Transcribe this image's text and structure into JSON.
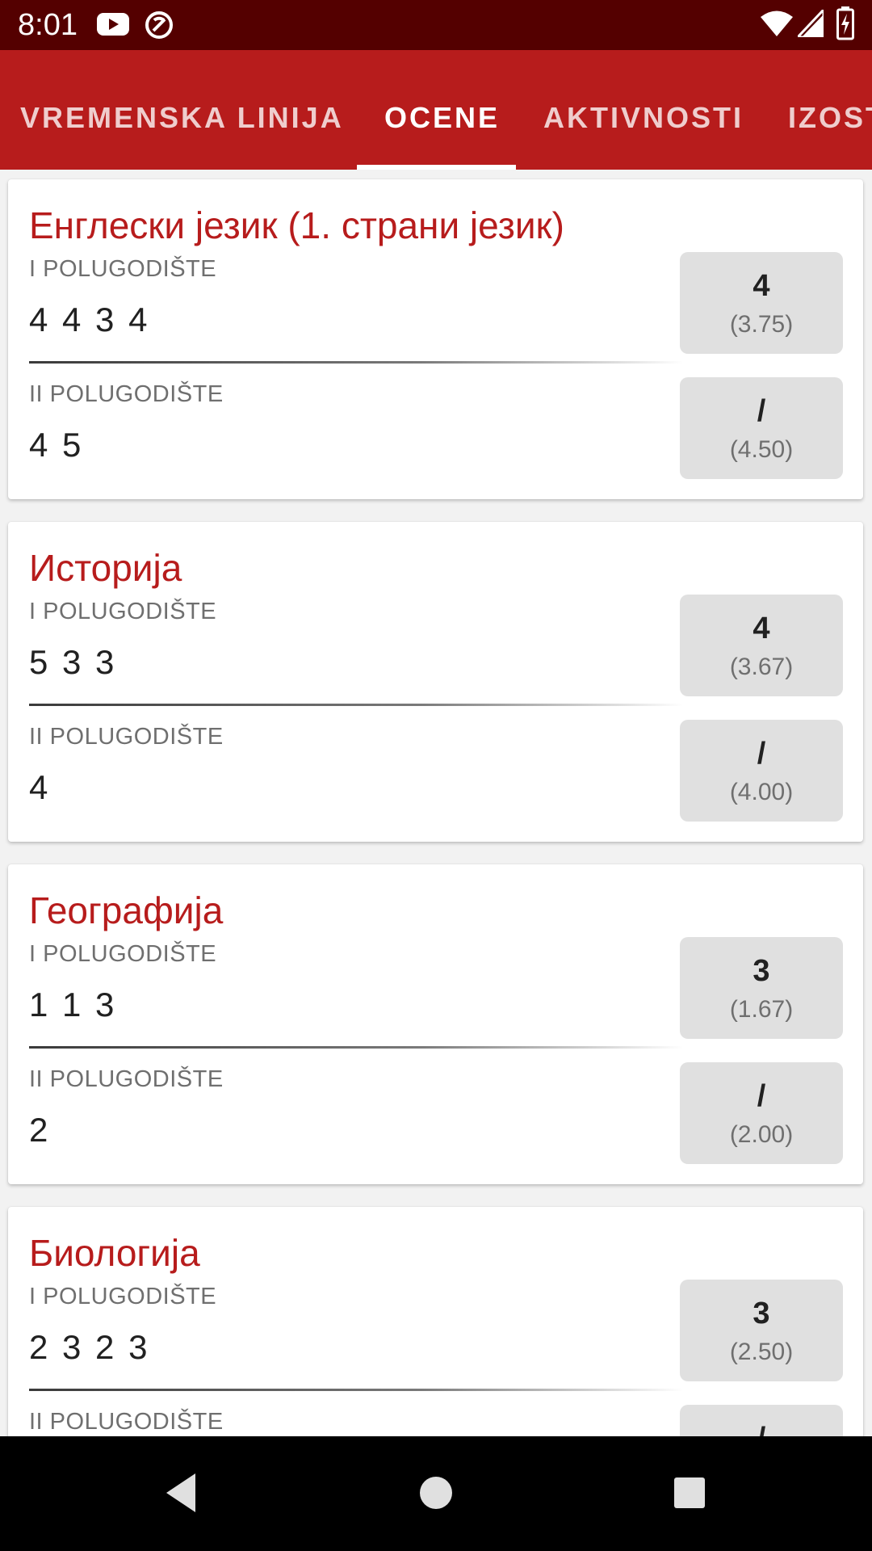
{
  "status_bar": {
    "time": "8:01",
    "icons": [
      "youtube-icon",
      "notification-icon",
      "wifi-icon",
      "signal-icon",
      "battery-charging-icon"
    ]
  },
  "tabs": [
    {
      "label": "VREMENSKA LINIJA",
      "active": false
    },
    {
      "label": "OCENE",
      "active": true
    },
    {
      "label": "AKTIVNOSTI",
      "active": false
    },
    {
      "label": "IZOSTANCI",
      "active": false
    }
  ],
  "subjects": [
    {
      "name": "Енглески језик (1. страни језик)",
      "terms": [
        {
          "label": "I POLUGODIŠTE",
          "grades": "4 4 3 4",
          "final": "4",
          "average": "(3.75)"
        },
        {
          "label": "II POLUGODIŠTE",
          "grades": "4 5",
          "final": "/",
          "average": "(4.50)"
        }
      ]
    },
    {
      "name": "Историја",
      "terms": [
        {
          "label": "I POLUGODIŠTE",
          "grades": "5 3 3",
          "final": "4",
          "average": "(3.67)"
        },
        {
          "label": "II POLUGODIŠTE",
          "grades": "4",
          "final": "/",
          "average": "(4.00)"
        }
      ]
    },
    {
      "name": "Географија",
      "terms": [
        {
          "label": "I POLUGODIŠTE",
          "grades": "1 1 3",
          "final": "3",
          "average": "(1.67)"
        },
        {
          "label": "II POLUGODIŠTE",
          "grades": "2",
          "final": "/",
          "average": "(2.00)"
        }
      ]
    },
    {
      "name": "Биологија",
      "terms": [
        {
          "label": "I POLUGODIŠTE",
          "grades": "2 3 2 3",
          "final": "3",
          "average": "(2.50)"
        },
        {
          "label": "II POLUGODIŠTE",
          "grades": "",
          "final": "/",
          "average": ""
        }
      ]
    }
  ],
  "navigation": [
    "back-icon",
    "home-icon",
    "recents-icon"
  ],
  "colors": {
    "status_bar": "#540000",
    "app_bar": "#b71c1c",
    "subject_title": "#b71c1c",
    "grade_box": "#e0e0e0"
  }
}
